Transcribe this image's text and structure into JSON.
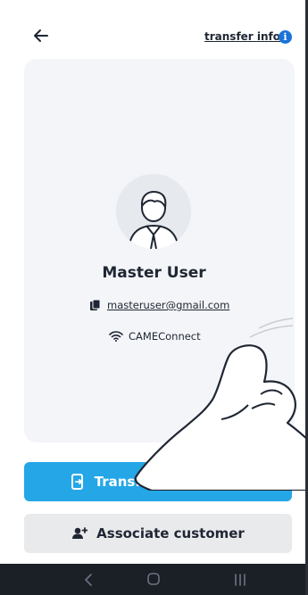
{
  "header": {
    "back_icon": "arrow-left-icon",
    "transfer_info_label": "transfer info",
    "info_icon_glyph": "i"
  },
  "profile": {
    "name": "Master User",
    "email": "masteruser@gmail.com",
    "network": "CAMEConnect",
    "avatar_icon": "user-avatar-icon"
  },
  "actions": {
    "primary_label": "Transfer installation",
    "secondary_label": "Associate customer"
  },
  "colors": {
    "primary": "#25a6e6",
    "secondary": "#e9eaec",
    "info_badge": "#1a73d9",
    "navbar": "#1b1f26"
  }
}
